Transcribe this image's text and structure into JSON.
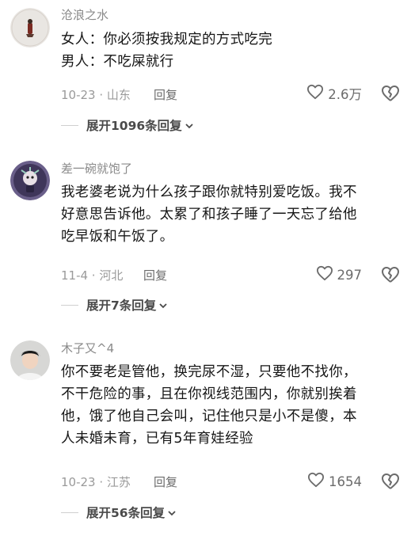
{
  "comments": [
    {
      "username": "沧浪之水",
      "content": "女人：你必须按我规定的方式吃完\n男人：不吃屎就行",
      "date_loc": "10-23 · 山东",
      "reply_label": "回复",
      "likes": "2.6万",
      "expand_label": "展开1096条回复"
    },
    {
      "username": "差一碗就饱了",
      "content": "我老婆老说为什么孩子跟你就特别爱吃饭。我不\n好意思告诉他。太累了和孩子睡了一天忘了给他\n吃早饭和午饭了。",
      "date_loc": "11-4 · 河北",
      "reply_label": "回复",
      "likes": "297",
      "expand_label": "展开7条回复"
    },
    {
      "username": "木子又^4",
      "content": "你不要老是管他，换完尿不湿，只要他不找你，\n不干危险的事，且在你视线范围内，你就别挨着\n他，饿了他自己会叫，记住他只是小不是傻，本\n人未婚未育，已有5年育娃经验",
      "date_loc": "10-23 · 江苏",
      "reply_label": "回复",
      "likes": "1654",
      "expand_label": "展开56条回复"
    }
  ],
  "icons": {
    "like": "heart-outline-icon",
    "dislike": "broken-heart-icon",
    "expand": "chevron-down-icon"
  },
  "colors": {
    "text_primary": "#161616",
    "text_secondary": "#8a8a8a",
    "icon": "#6b6b6b"
  }
}
